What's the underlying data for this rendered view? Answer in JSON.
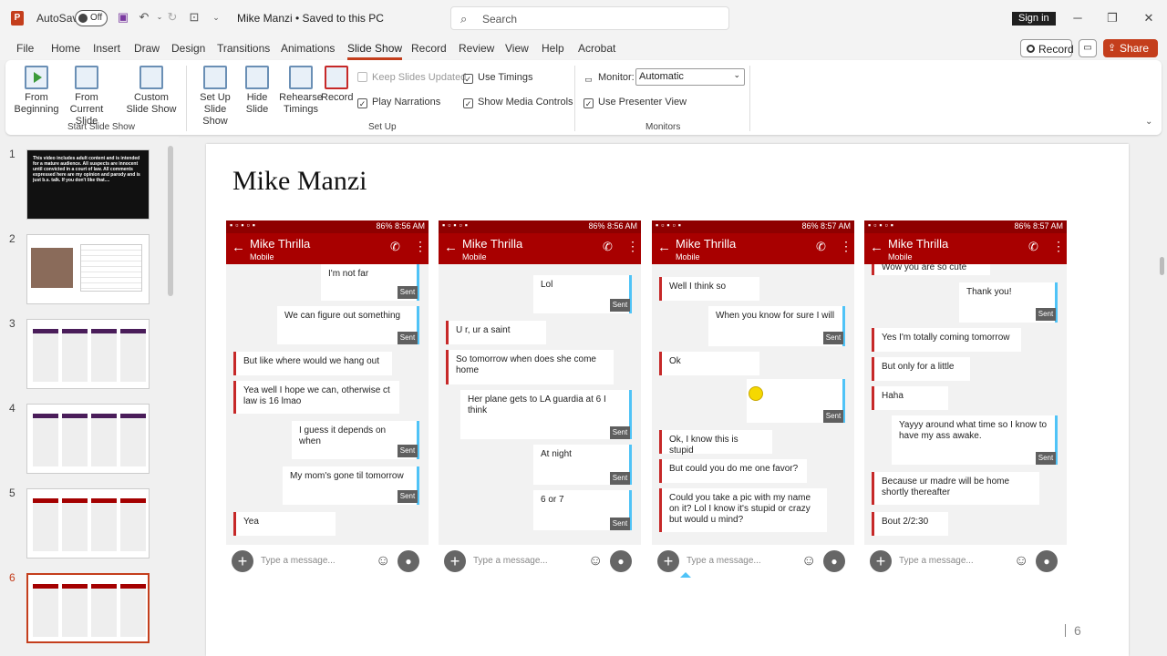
{
  "titlebar": {
    "autosave_label": "AutoSave",
    "autosave_state": "Off",
    "doc_title": "Mike Manzi • Saved to this PC",
    "search_placeholder": "Search",
    "sign_in": "Sign in"
  },
  "tabs": [
    "File",
    "Home",
    "Insert",
    "Draw",
    "Design",
    "Transitions",
    "Animations",
    "Slide Show",
    "Record",
    "Review",
    "View",
    "Help",
    "Acrobat"
  ],
  "active_tab": "Slide Show",
  "actions": {
    "record": "Record",
    "share": "Share"
  },
  "ribbon": {
    "from_beginning": "From Beginning",
    "from_current_slide": "From Current Slide",
    "custom_slide_show": "Custom Slide Show",
    "group_start": "Start Slide Show",
    "set_up_slide_show": "Set Up Slide Show",
    "hide_slide": "Hide Slide",
    "rehearse_timings": "Rehearse Timings",
    "record": "Record",
    "keep_slides_updated": "Keep Slides Updated",
    "use_timings": "Use Timings",
    "play_narrations": "Play Narrations",
    "show_media_controls": "Show Media Controls",
    "group_setup": "Set Up",
    "monitor_label": "Monitor:",
    "monitor_value": "Automatic",
    "use_presenter_view": "Use Presenter View",
    "group_monitors": "Monitors"
  },
  "thumb1_text": "This video includes adult content and is intended for a mature audience. All suspects are innocent until convicted in a court of law. All comments expressed here are my opinion and parody and is just b.s. talk. If you don't like that....",
  "slide": {
    "title": "Mike Manzi",
    "page_number": "6"
  },
  "phones": [
    {
      "battery": "86%",
      "time": "8:56 AM",
      "contact": "Mike Thrilla",
      "subtitle": "Mobile",
      "placeholder": "Type a message..."
    },
    {
      "battery": "86%",
      "time": "8:56 AM",
      "contact": "Mike Thrilla",
      "subtitle": "Mobile",
      "placeholder": "Type a message..."
    },
    {
      "battery": "86%",
      "time": "8:57 AM",
      "contact": "Mike Thrilla",
      "subtitle": "Mobile",
      "placeholder": "Type a message..."
    },
    {
      "battery": "86%",
      "time": "8:57 AM",
      "contact": "Mike Thrilla",
      "subtitle": "Mobile",
      "placeholder": "Type a message..."
    }
  ],
  "sent_label": "Sent",
  "messages": {
    "p1": {
      "m1": "I'm not far",
      "m2": "We can figure out something",
      "m3": "But like where would we hang out",
      "m4": "Yea well I hope we can, otherwise ct law is 16 lmao",
      "m5": "I guess it depends on when",
      "m6": "My mom's gone til tomorrow",
      "m7": "Yea"
    },
    "p2": {
      "m1": "Lol",
      "m2": "U r, ur a saint",
      "m3": "So tomorrow when does she come home",
      "m4": "Her plane gets to LA guardia at 6 I think",
      "m5": "At night",
      "m6": "6 or 7"
    },
    "p3": {
      "m1": "Well I think so",
      "m2": "When you know for sure I will",
      "m3": "Ok",
      "m4": "Ok, I know this is stupid",
      "m5": "But could you do me one favor?",
      "m6": "Could you take a pic with my name on it? Lol I know it's stupid or crazy but would u mind?"
    },
    "p4": {
      "m0": "Wow you are so cute",
      "m1": "Thank you!",
      "m2": "Yes I'm totally coming tomorrow",
      "m3": "But only for a little",
      "m4": "Haha",
      "m5": "Yayyy around what time so I know to have my ass awake.",
      "m6": "Because ur madre will be home shortly thereafter",
      "m7": "Bout 2/2:30"
    }
  },
  "colors": {
    "accent": "#c43e1c",
    "sms_header": "#a80000",
    "outgoing_bar": "#4fc3f7",
    "incoming_bar": "#c62828"
  }
}
